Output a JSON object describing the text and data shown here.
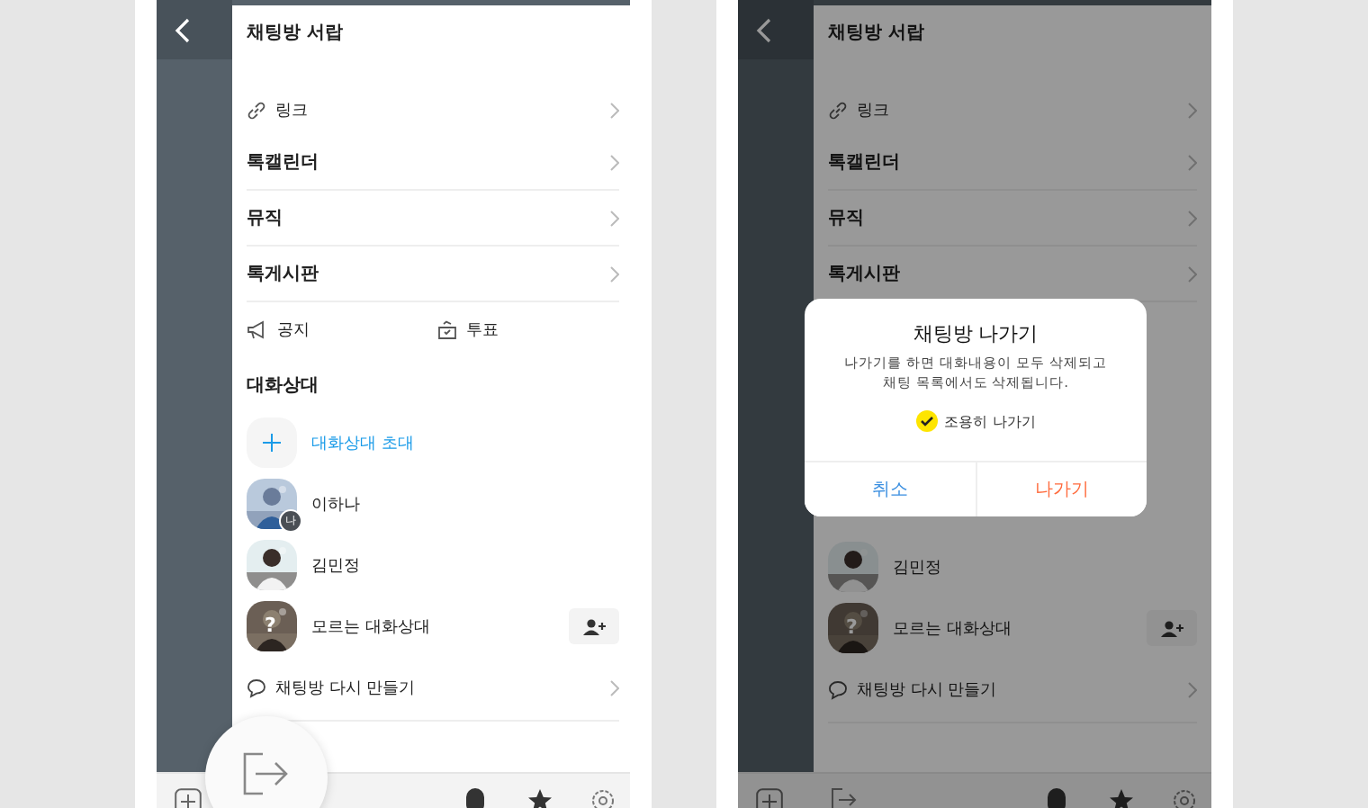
{
  "screens": [
    {
      "drawer_title": "채팅방 서랍",
      "exit_floating": true,
      "rows": [
        {
          "kind": "icon-link",
          "label": "링크"
        },
        {
          "kind": "menu",
          "label": "톡캘린더"
        },
        {
          "kind": "menu",
          "label": "뮤직"
        },
        {
          "kind": "menu",
          "label": "톡게시판"
        },
        {
          "kind": "pair",
          "items": [
            {
              "label": "공지"
            },
            {
              "label": "투표"
            }
          ]
        },
        {
          "kind": "heading",
          "label": "대화상대"
        },
        {
          "kind": "invite",
          "label": "대화상대 초대"
        },
        {
          "kind": "member",
          "name": "이하나",
          "badge": "나"
        },
        {
          "kind": "member",
          "name": "김민정"
        },
        {
          "kind": "member",
          "name": "모르는 대화상대",
          "mark": "?",
          "add_friend": true
        },
        {
          "kind": "icon-chat",
          "label": "채팅방 다시 만들기"
        }
      ]
    },
    {
      "drawer_title": "채팅방 서랍",
      "exit_floating": false,
      "rows": [
        {
          "kind": "icon-link",
          "label": "링크"
        },
        {
          "kind": "menu",
          "label": "톡캘린더"
        },
        {
          "kind": "menu",
          "label": "뮤직"
        },
        {
          "kind": "menu",
          "label": "톡게시판"
        },
        {
          "kind": "dialog",
          "title": "채팅방 나가기",
          "message": "나가기를 하면 대화내용이 모두 삭제되고\n채팅 목록에서도 삭제됩니다.",
          "option": {
            "label": "조용히 나가기",
            "checked": true
          },
          "buttons": [
            {
              "kind": "cancel",
              "label": "취소"
            },
            {
              "kind": "confirm",
              "label": "나가기"
            }
          ]
        },
        {
          "kind": "member",
          "name": "김민정"
        },
        {
          "kind": "member",
          "name": "모르는 대화상대",
          "mark": "?",
          "add_friend": true
        },
        {
          "kind": "icon-chat",
          "label": "채팅방 다시 만들기"
        }
      ]
    }
  ]
}
